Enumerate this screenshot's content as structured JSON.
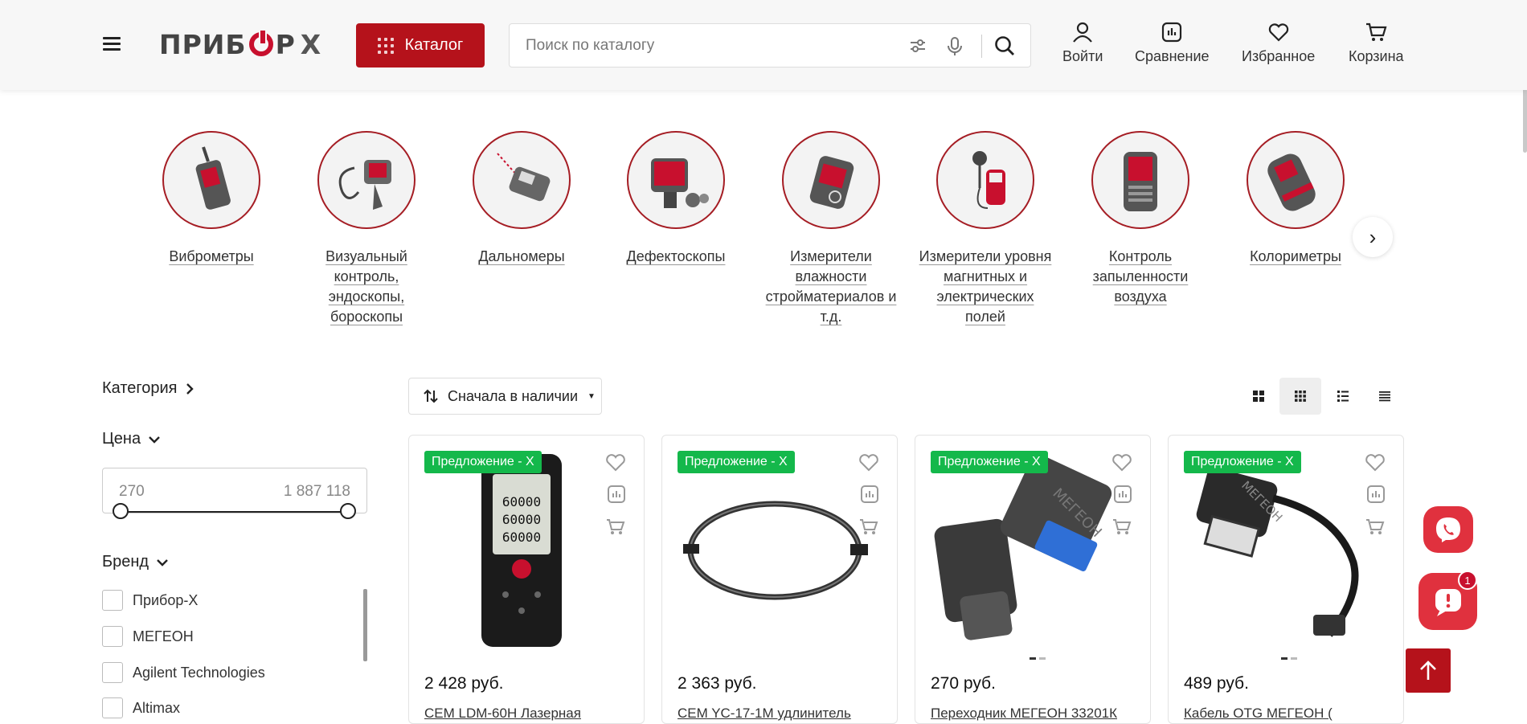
{
  "header": {
    "logo_text": "ПРИБОРX",
    "catalog_label": "Каталог",
    "search_placeholder": "Поиск по каталогу",
    "nav": [
      {
        "label": "Войти",
        "icon": "user-icon"
      },
      {
        "label": "Сравнение",
        "icon": "compare-icon"
      },
      {
        "label": "Избранное",
        "icon": "heart-icon"
      },
      {
        "label": "Корзина",
        "icon": "cart-icon"
      }
    ]
  },
  "categories": [
    {
      "label": "Виброметры"
    },
    {
      "label": "Визуальный контроль, эндоскопы, бороскопы"
    },
    {
      "label": "Дальномеры"
    },
    {
      "label": "Дефектоскопы"
    },
    {
      "label": "Измерители влажности стройматериалов и т.д."
    },
    {
      "label": "Измерители уровня магнитных и электрических полей"
    },
    {
      "label": "Контроль запыленности воздуха"
    },
    {
      "label": "Колориметры"
    }
  ],
  "filters": {
    "category_title": "Категория",
    "price_title": "Цена",
    "price_min": "270",
    "price_max": "1 887 118",
    "brand_title": "Бренд",
    "brands": [
      "Прибор-Х",
      "МЕГЕОН",
      "Agilent Technologies",
      "Altimax"
    ]
  },
  "toolbar": {
    "sort_label": "Сначала в наличии"
  },
  "products": [
    {
      "badge": "Предложение - X",
      "price": "2 428 руб.",
      "name": "CEM LDM-60H Лазерная"
    },
    {
      "badge": "Предложение - X",
      "price": "2 363 руб.",
      "name": "CEM YC-17-1M удлинитель"
    },
    {
      "badge": "Предложение - X",
      "price": "270 руб.",
      "name": "Переходник МЕГЕОН 33201К"
    },
    {
      "badge": "Предложение - X",
      "price": "489 руб.",
      "name": "Кабель OTG МЕГЕОН ("
    }
  ],
  "chat_badge_count": "1",
  "colors": {
    "brand_red": "#b5121b",
    "badge_green": "#14b84b",
    "float_red": "#e0313e"
  }
}
